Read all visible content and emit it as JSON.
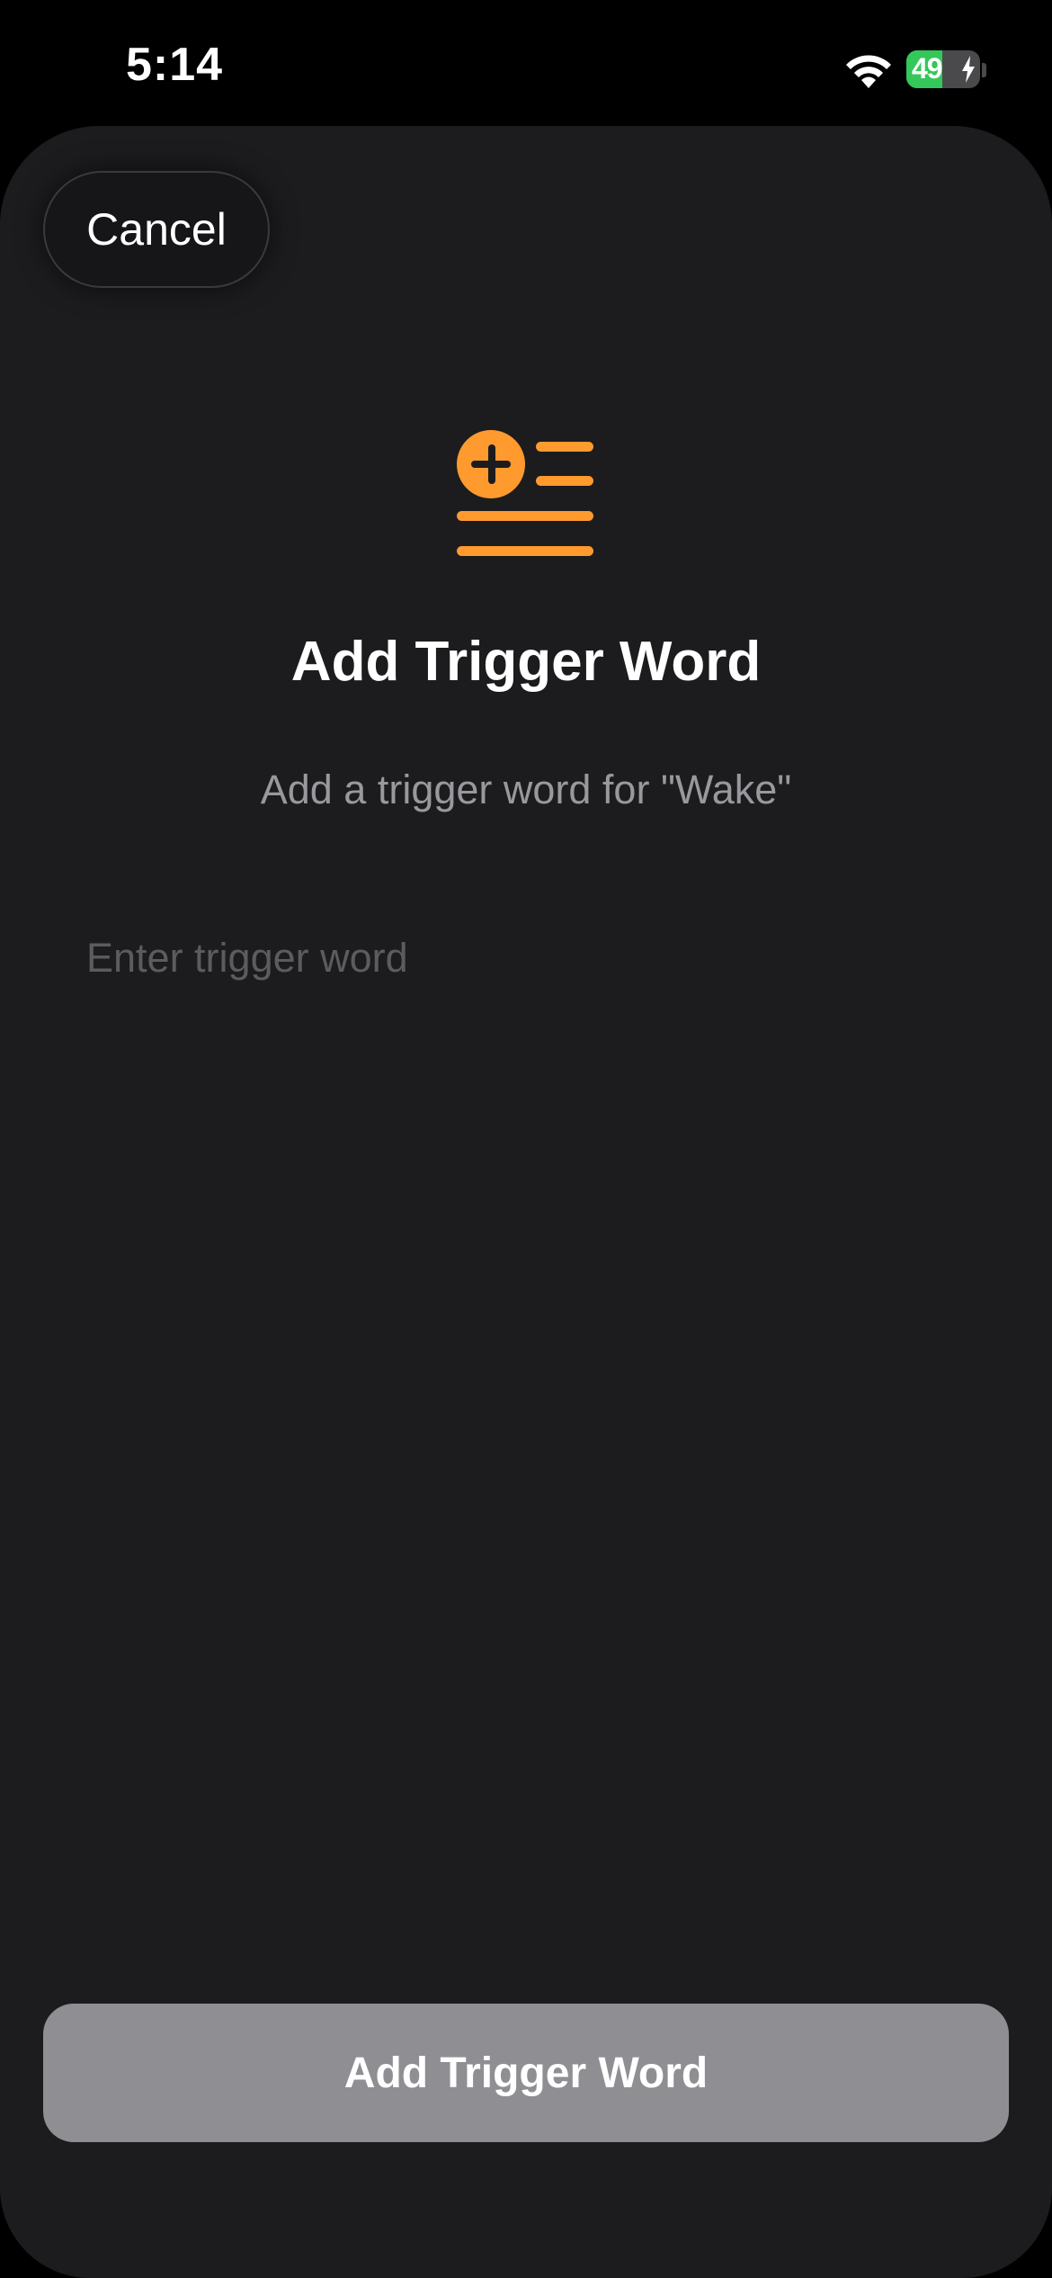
{
  "status_bar": {
    "time": "5:14",
    "battery_percent": 49,
    "battery_label": "49",
    "battery_color": "#34c759",
    "charging": true
  },
  "sheet": {
    "cancel_label": "Cancel",
    "icon": "add-list-icon",
    "accent_color": "#ff9a2e",
    "title": "Add Trigger Word",
    "subtitle": "Add a trigger word for \"Wake\"",
    "input": {
      "placeholder": "Enter trigger word",
      "value": ""
    },
    "submit_label": "Add Trigger Word",
    "submit_enabled": false
  }
}
